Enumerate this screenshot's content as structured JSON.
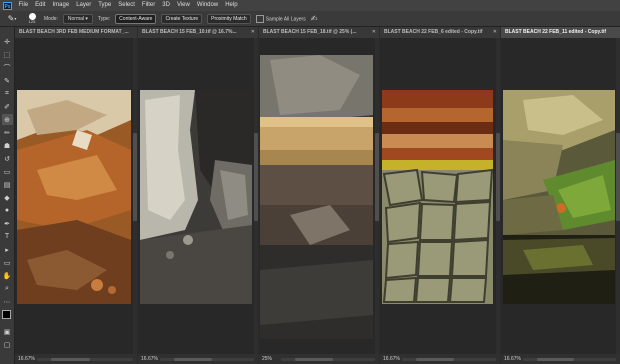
{
  "app": {
    "logo": "Ps"
  },
  "menu": {
    "items": [
      "File",
      "Edit",
      "Image",
      "Layer",
      "Type",
      "Select",
      "Filter",
      "3D",
      "View",
      "Window",
      "Help"
    ]
  },
  "options": {
    "brush_size": "125",
    "mode_label": "Mode:",
    "mode_value": "Normal",
    "type_label": "Type:",
    "type_buttons": [
      "Content-Aware",
      "Create Texture",
      "Proximity Match"
    ],
    "sample_all_layers": "Sample All Layers"
  },
  "documents": [
    {
      "tab": "BLAST BEACH 3RD FEB MEDIUM FORMAT_...",
      "zoom": "16.67%",
      "active": false
    },
    {
      "tab": "BLAST BEACH 15 FEB_10.tif @ 16.7%...",
      "zoom": "16.67%",
      "active": false
    },
    {
      "tab": "BLAST BEACH 15 FEB_18.tif @ 25% (...",
      "zoom": "25%",
      "active": false
    },
    {
      "tab": "BLAST BEACH 22 FEB_6 edited - Copy.tif",
      "zoom": "16.67%",
      "active": false
    },
    {
      "tab": "BLAST BEACH 22 FEB_11 edited - Copy.tif",
      "zoom": "16.67%",
      "active": true
    }
  ],
  "tools": [
    "move-icon",
    "marquee-icon",
    "lasso-icon",
    "quick-select-icon",
    "crop-icon",
    "eyedropper-icon",
    "healing-brush-icon",
    "brush-icon",
    "clone-stamp-icon",
    "history-brush-icon",
    "eraser-icon",
    "gradient-icon",
    "blur-icon",
    "dodge-icon",
    "pen-icon",
    "type-icon",
    "path-select-icon",
    "rectangle-icon",
    "hand-icon",
    "zoom-icon",
    "more-tools-icon"
  ],
  "colors": {
    "accent": "#31a8ff",
    "foreground": "#000000",
    "background": "#ffffff"
  }
}
